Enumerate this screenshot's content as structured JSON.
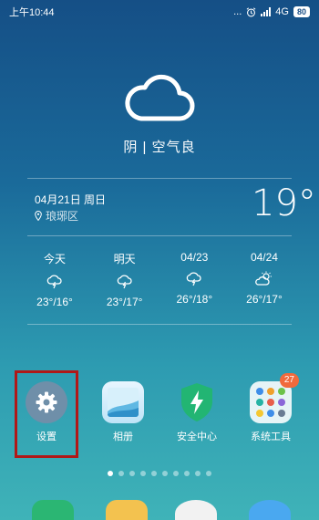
{
  "status_bar": {
    "time": "上午10:44",
    "dots": "...",
    "network": "4G",
    "battery": "80"
  },
  "weather": {
    "description": "阴 | 空气良",
    "date": "04月21日 周日",
    "location": "琅琊区",
    "current_temp": "19°",
    "forecast": [
      {
        "day": "今天",
        "icon": "thunder-rain-icon",
        "temps": "23°/16°"
      },
      {
        "day": "明天",
        "icon": "thunder-rain-icon",
        "temps": "23°/17°"
      },
      {
        "day": "04/23",
        "icon": "thunder-rain-icon",
        "temps": "26°/18°"
      },
      {
        "day": "04/24",
        "icon": "partly-cloudy-icon",
        "temps": "26°/17°"
      }
    ]
  },
  "apps": [
    {
      "label": "设置",
      "icon": "gear-icon"
    },
    {
      "label": "相册",
      "icon": "gallery-icon"
    },
    {
      "label": "安全中心",
      "icon": "security-shield-icon"
    },
    {
      "label": "系统工具",
      "icon": "folder-icon",
      "badge": "27"
    }
  ],
  "page_indicator": {
    "count": 10,
    "active": 0
  },
  "colors": {
    "settings_bg": "#6f8fa9",
    "security_green": "#22b573",
    "badge": "#f06a3c",
    "highlight": "#b01818"
  }
}
